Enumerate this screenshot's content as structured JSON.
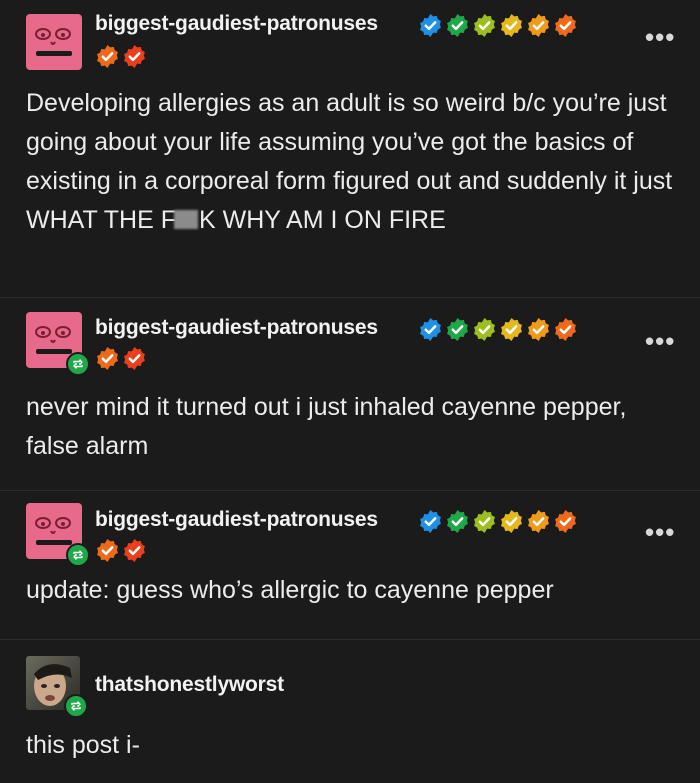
{
  "posts": [
    {
      "username": "biggest-gaudiest-patronuses",
      "avatar_icon": "pink-face-avatar",
      "reblog": false,
      "text_before": "Developing allergies as an adult is so weird b/c you’re just going about your life assuming you’ve got the basics of existing in a corporeal form figured out and suddenly it just WHAT THE F",
      "text_after": "K WHY AM I ON FIRE",
      "censored": true,
      "more_label": "•••"
    },
    {
      "username": "biggest-gaudiest-patronuses",
      "avatar_icon": "pink-face-avatar",
      "reblog": true,
      "text": "never mind it turned out i just inhaled cayenne pepper, false alarm",
      "more_label": "•••"
    },
    {
      "username": "biggest-gaudiest-patronuses",
      "avatar_icon": "pink-face-avatar",
      "reblog": true,
      "text": "update: guess who’s allergic to cayenne pepper",
      "more_label": "•••"
    },
    {
      "username": "thatshonestlyworst",
      "avatar_icon": "photo-avatar",
      "reblog": true,
      "text": "this post i-"
    }
  ],
  "badge_colors": {
    "blue": "#1e90e6",
    "green": "#1fa84a",
    "yellowgreen": "#9cbf1e",
    "yellow": "#e6b81c",
    "orange": "#f09a1a",
    "deeporange": "#ee6a1a",
    "red": "#e8401c",
    "reblog": "#1fa84a"
  }
}
